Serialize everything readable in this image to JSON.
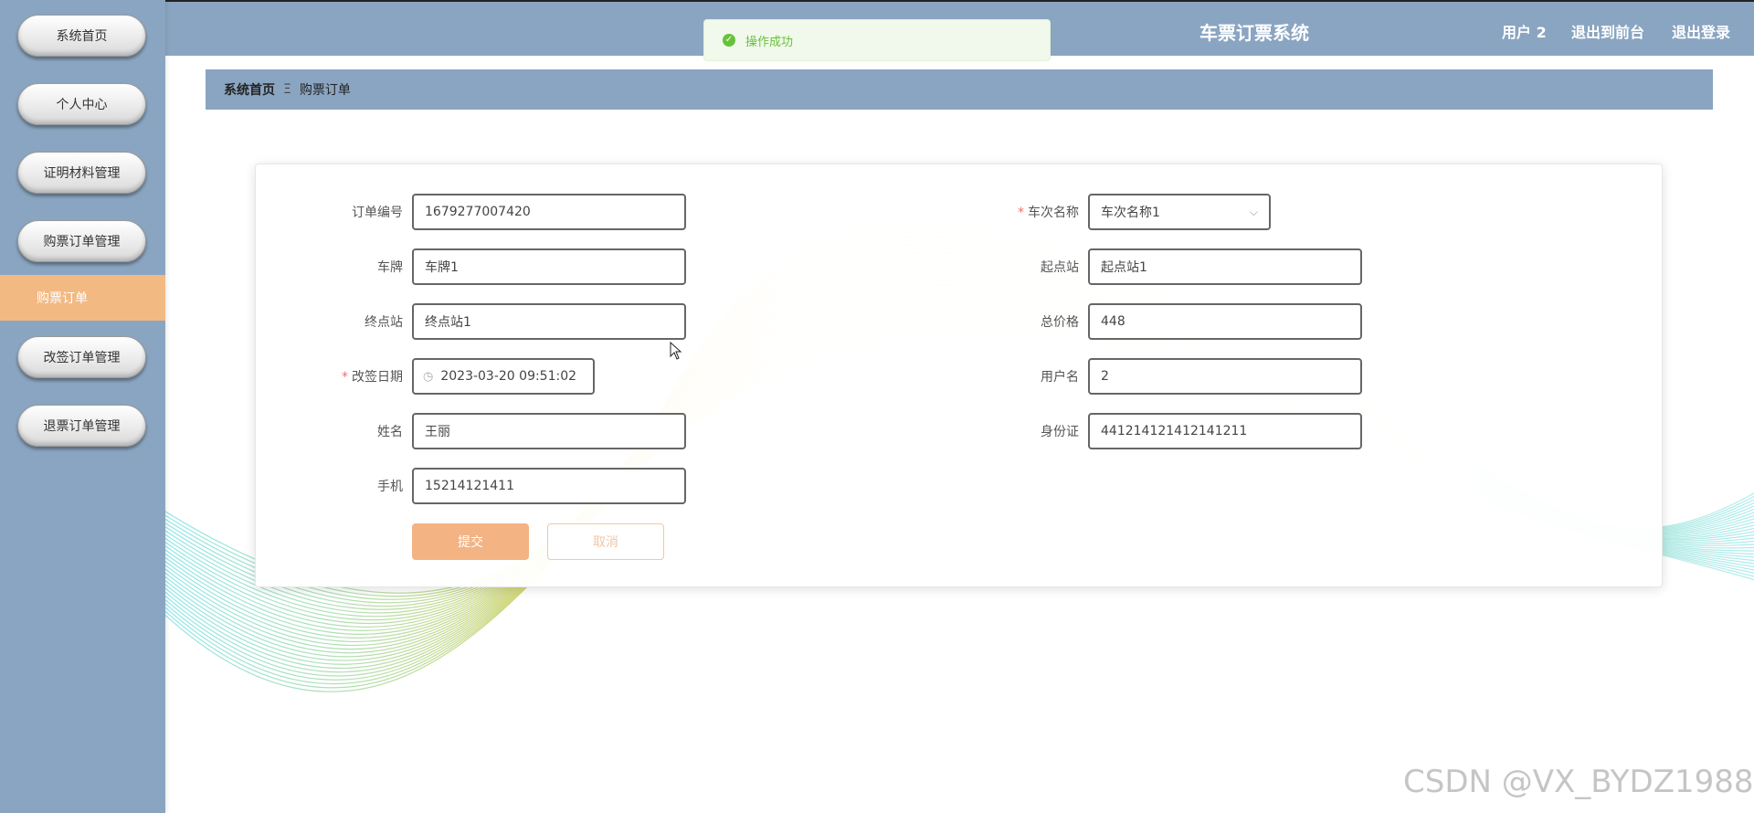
{
  "header": {
    "app_title": "车票订票系统",
    "user_label": "用户 2",
    "back_to_front": "退出到前台",
    "logout": "退出登录"
  },
  "toast": {
    "message": "操作成功"
  },
  "sidebar": {
    "items": [
      {
        "label": "系统首页"
      },
      {
        "label": "个人中心"
      },
      {
        "label": "证明材料管理"
      },
      {
        "label": "购票订单管理"
      },
      {
        "label": "购票订单",
        "active": true
      },
      {
        "label": "改签订单管理"
      },
      {
        "label": "退票订单管理"
      }
    ]
  },
  "breadcrumb": {
    "home": "系统首页",
    "separator": "Ξ",
    "current": "购票订单"
  },
  "form": {
    "order_no": {
      "label": "订单编号",
      "value": "1679277007420"
    },
    "train_name": {
      "label": "车次名称",
      "value": "车次名称1",
      "required": true
    },
    "plate": {
      "label": "车牌",
      "value": "车牌1"
    },
    "origin": {
      "label": "起点站",
      "value": "起点站1"
    },
    "destination": {
      "label": "终点站",
      "value": "终点站1"
    },
    "total_price": {
      "label": "总价格",
      "value": "448"
    },
    "change_date": {
      "label": "改签日期",
      "value": "2023-03-20 09:51:02",
      "required": true
    },
    "username": {
      "label": "用户名",
      "value": "2"
    },
    "name": {
      "label": "姓名",
      "value": "王丽"
    },
    "id_card": {
      "label": "身份证",
      "value": "441214121412141211"
    },
    "phone": {
      "label": "手机",
      "value": "15214121411"
    },
    "submit_label": "提交",
    "cancel_label": "取消"
  },
  "watermark": "CSDN @VX_BYDZ1988",
  "colors": {
    "sidebar_bg": "#8aa5c1",
    "accent": "#f3b383",
    "success": "#67c23a",
    "required": "#f56c6c"
  }
}
